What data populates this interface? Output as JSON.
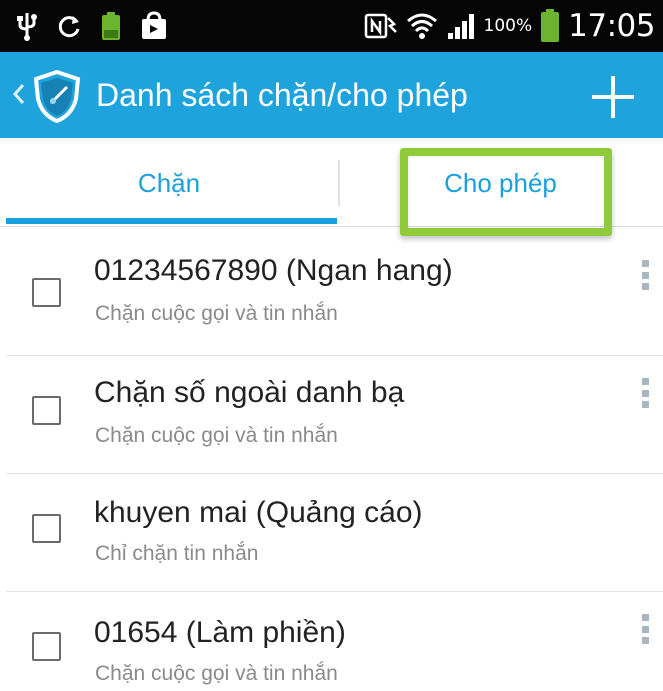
{
  "status_bar": {
    "battery_percent": "100%",
    "time": "17:05"
  },
  "action_bar": {
    "title": "Danh sách chặn/cho phép"
  },
  "tabs": [
    {
      "label": "Chặn",
      "selected": true
    },
    {
      "label": "Cho phép",
      "selected": false
    }
  ],
  "list": {
    "items": [
      {
        "title": "01234567890 (Ngan hang)",
        "subtitle": "Chặn cuộc gọi và tin nhắn",
        "checked": false,
        "has_menu": true
      },
      {
        "title": "Chặn số ngoài danh bạ",
        "subtitle": "Chặn cuộc gọi và tin nhắn",
        "checked": false,
        "has_menu": true
      },
      {
        "title": "khuyen mai (Quảng cáo)",
        "subtitle": "Chỉ chặn tin nhắn",
        "checked": false,
        "has_menu": false
      },
      {
        "title": "01654 (Làm phiền)",
        "subtitle": "Chặn cuộc gọi và tin nhắn",
        "checked": false,
        "has_menu": true
      }
    ]
  },
  "colors": {
    "action_bar": "#1ea3dc",
    "accent": "#1aa0dc",
    "highlight": "#8fcb3a",
    "status_bar": "#050505"
  },
  "icons": [
    "usb-icon",
    "sync-icon",
    "battery-small-icon",
    "shopping-bag-icon",
    "nfc-icon",
    "wifi-icon",
    "signal-icon",
    "battery-icon",
    "back-chevron-icon",
    "shield-logo-icon",
    "add-icon",
    "overflow-menu-icon"
  ]
}
